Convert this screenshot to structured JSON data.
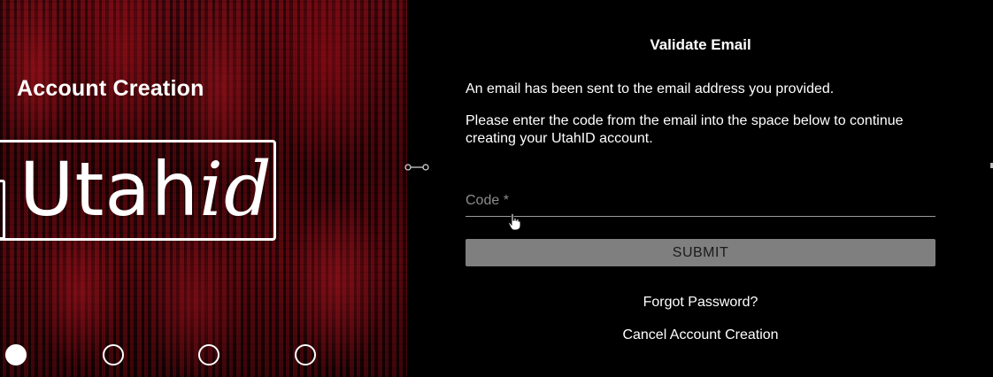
{
  "left_panel": {
    "title": "Account Creation",
    "logo": {
      "text_main": "Utah",
      "text_italic": "id"
    },
    "steps": [
      {
        "state": "active"
      },
      {
        "state": "inactive"
      },
      {
        "state": "inactive"
      },
      {
        "state": "inactive"
      }
    ]
  },
  "form": {
    "title": "Validate Email",
    "message_sent": "An email has been sent to the email address you provided.",
    "instructions": "Please enter the code from the email into the space below to continue creating your UtahID account.",
    "code_field": {
      "label": "Code *",
      "value": ""
    },
    "submit_label": "SUBMIT",
    "forgot_password": "Forgot Password?",
    "cancel": "Cancel Account Creation"
  },
  "colors": {
    "background": "#000000",
    "panel_accent": "#7a0a14",
    "submit_bg": "#7f7f7f",
    "label_gray": "#8c8c8c"
  },
  "icons": {
    "cursor": "hand-pointer-icon",
    "handle": "drag-handle-icon"
  }
}
